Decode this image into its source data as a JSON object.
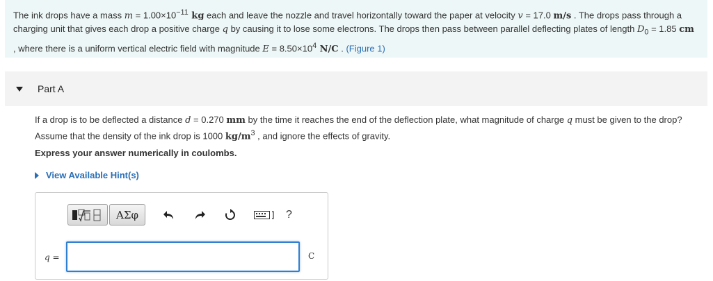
{
  "intro": {
    "s1": "The ink drops have a mass ",
    "m_var": "m",
    "m_eq": " = 1.00×10",
    "m_exp": "−11",
    "m_unit": " kg",
    "s2": " each and leave the nozzle and travel horizontally toward the paper at velocity ",
    "v_var": "v",
    "v_eq": " = 17.0 ",
    "v_unit": "m/s",
    "s3": " . The drops pass through a charging unit that gives each drop a positive charge ",
    "q_var": "q",
    "s4": " by causing it to lose some electrons. The drops then pass between parallel deflecting plates of length ",
    "d0_var": "D",
    "d0_sub": "0",
    "d0_eq": " = 1.85 ",
    "d0_unit": "cm",
    "s5": " , where there is a uniform vertical electric field with magnitude ",
    "e_var": "E",
    "e_eq": " = 8.50×10",
    "e_exp": "4",
    "e_unit": " N/C",
    "s6": " . ",
    "figure_link": "(Figure 1)"
  },
  "part": {
    "title": "Part A",
    "q1": "If a drop is to be deflected a distance ",
    "d_var": "d",
    "d_eq": " = 0.270 ",
    "d_unit": "mm",
    "q2": " by the time it reaches the end of the deflection plate, what magnitude of charge ",
    "q_var": "q",
    "q3": " must be given to the drop? Assume that the density of the ink drop is 1000 ",
    "rho_unit": "kg/m",
    "rho_exp": "3",
    "q4": " , and ignore the effects of gravity.",
    "instruction": "Express your answer numerically in coulombs.",
    "hint_label": "View Available Hint(s)"
  },
  "answer": {
    "label_var": "q",
    "label_eq": " =",
    "input_value": "",
    "unit": "C",
    "greek_label": "ΑΣφ",
    "help_label": "?"
  }
}
